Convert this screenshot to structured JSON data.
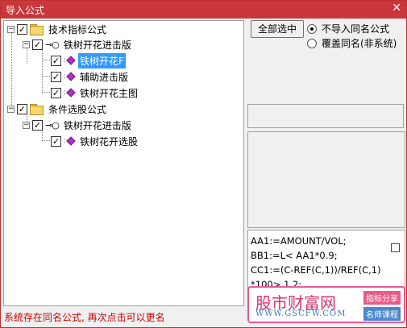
{
  "window": {
    "title": "导入公式",
    "close_glyph": "✕"
  },
  "tree": {
    "nodes": [
      {
        "label": "技术指标公式",
        "type": "folder",
        "checked": true,
        "expanded": true
      },
      {
        "label": "铁树开花进击版",
        "type": "group",
        "checked": true,
        "expanded": true
      },
      {
        "label": "铁树开花F",
        "type": "formula",
        "checked": true,
        "selected": true
      },
      {
        "label": "辅助进击版",
        "type": "formula",
        "checked": true
      },
      {
        "label": "铁树开花主图",
        "type": "formula",
        "checked": true
      },
      {
        "label": "条件选股公式",
        "type": "folder",
        "checked": true,
        "expanded": true
      },
      {
        "label": "铁树开花进击版",
        "type": "group",
        "checked": true,
        "expanded": true
      },
      {
        "label": "铁树花开选股",
        "type": "formula",
        "checked": true
      }
    ],
    "expander_glyph": "−",
    "check_glyph": "✓",
    "key_glyph": "⊸○"
  },
  "right": {
    "select_all_label": "全部选中",
    "radio_options": [
      {
        "label": "不导入同名公式",
        "selected": true
      },
      {
        "label": "覆盖同名(非系统)",
        "selected": false
      }
    ]
  },
  "code_preview": {
    "lines": [
      "AA1:=AMOUNT/VOL;",
      "BB1:=L< AA1*0.9;",
      "CC1:=(C-REF(C,1))/REF(C,1)",
      "*100> 1.2;"
    ]
  },
  "watermark": {
    "name": "股市财富网",
    "url": "WWW.GSCFW.COM",
    "tag1": "指标分享",
    "tag2": "名师课程"
  },
  "status": {
    "message": "系统存在同名公式, 再次点击可以更名"
  },
  "colors": {
    "titlebar": "#c9373b",
    "selection": "#3399ff",
    "status_text": "#d00000",
    "formula_icon": "#b62fc9"
  }
}
